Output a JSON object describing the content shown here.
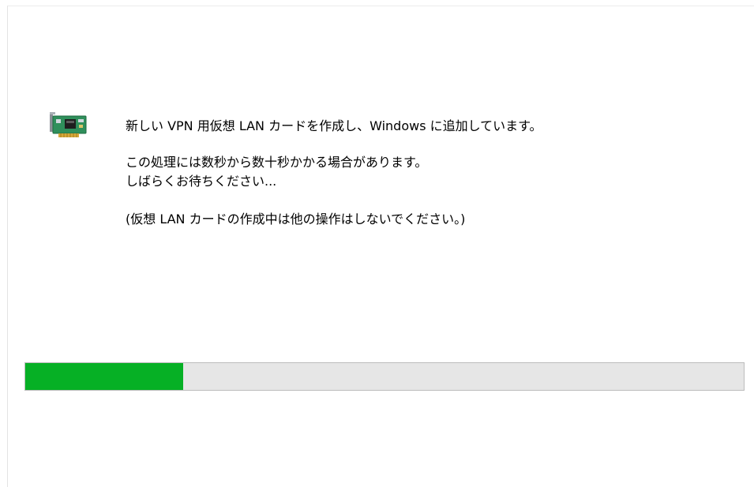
{
  "icon": {
    "name": "network-card-icon"
  },
  "message": {
    "line1": "新しい VPN 用仮想 LAN カードを作成し、Windows に追加しています。",
    "line2": "この処理には数秒から数十秒かかる場合があります。",
    "line3": "しばらくお待ちください...",
    "line4": "(仮想 LAN カードの作成中は他の操作はしないでください。)"
  },
  "progress": {
    "fraction": 0.22,
    "fill_color": "#06b025",
    "track_color": "#e6e6e6"
  }
}
